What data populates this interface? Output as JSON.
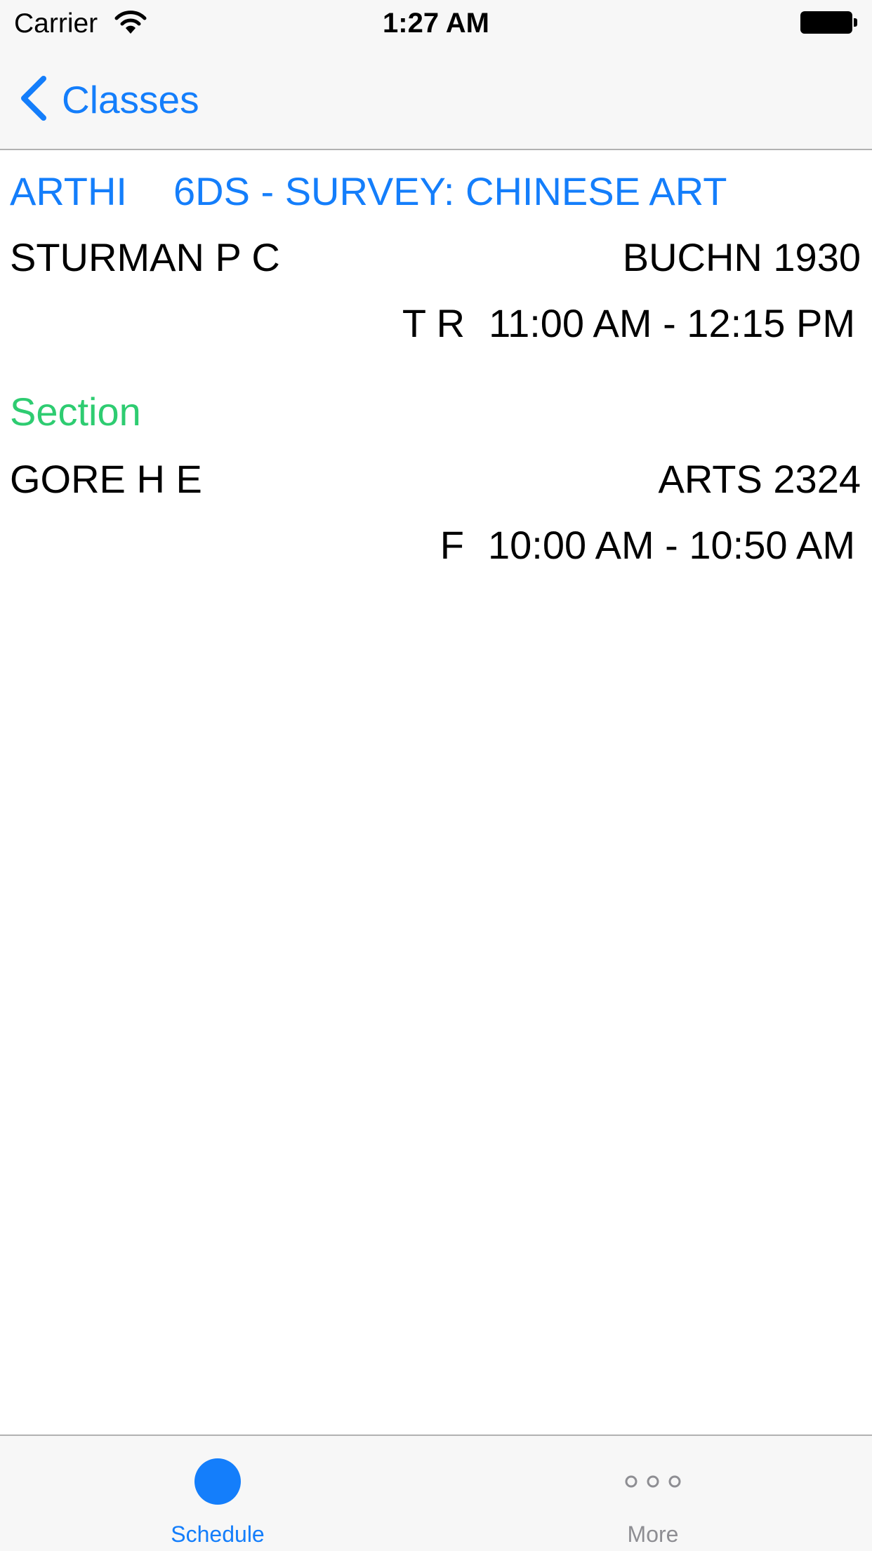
{
  "status_bar": {
    "carrier": "Carrier",
    "time": "1:27 AM",
    "wifi_icon": "wifi-icon",
    "battery_icon": "battery-icon"
  },
  "nav": {
    "back_label": "Classes",
    "back_icon": "chevron-left-icon"
  },
  "course": {
    "subject": "ARTHI",
    "title": "6DS - SURVEY: CHINESE ART",
    "instructor": "STURMAN P C",
    "location": "BUCHN 1930",
    "days": "T R",
    "time": "11:00 AM - 12:15 PM"
  },
  "section": {
    "heading": "Section",
    "instructor": "GORE H E",
    "location": "ARTS 2324",
    "days": "F",
    "time": "10:00 AM - 10:50 AM"
  },
  "tab_bar": {
    "items": [
      {
        "label": "Schedule",
        "icon": "filled-circle-icon",
        "selected": true
      },
      {
        "label": "More",
        "icon": "more-dots-icon",
        "selected": false
      }
    ]
  },
  "colors": {
    "accent": "#147efb",
    "section_heading": "#2ecc71",
    "bar_background": "#f7f7f7",
    "inactive_tab": "#8e8e93"
  }
}
